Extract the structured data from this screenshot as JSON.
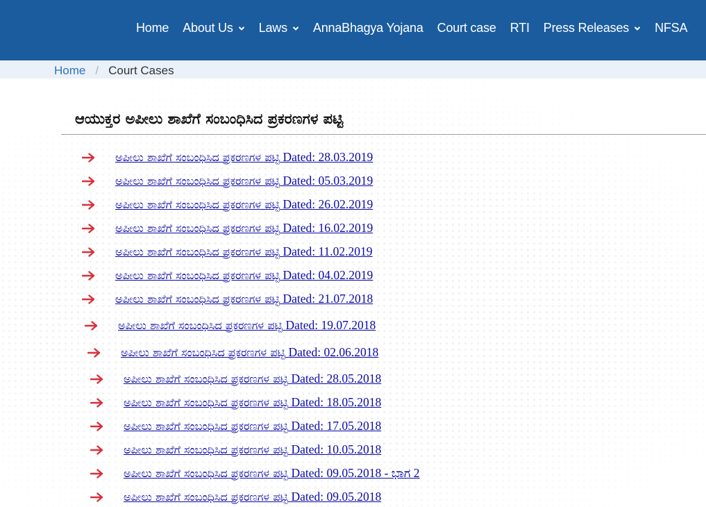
{
  "nav": {
    "items": [
      {
        "label": "Home",
        "has_dropdown": false
      },
      {
        "label": "About Us",
        "has_dropdown": true
      },
      {
        "label": "Laws",
        "has_dropdown": true
      },
      {
        "label": "AnnaBhagya Yojana",
        "has_dropdown": false
      },
      {
        "label": "Court case",
        "has_dropdown": false
      },
      {
        "label": "RTI",
        "has_dropdown": false
      },
      {
        "label": "Press Releases",
        "has_dropdown": true
      },
      {
        "label": "NFSA",
        "has_dropdown": false
      }
    ]
  },
  "breadcrumb": {
    "home": "Home",
    "separator": "/",
    "current": "Court Cases"
  },
  "page": {
    "title": "ಆಯುಕ್ತರ ಅಪೀಲು ಶಾಖೆಗೆ ಸಂಬಂಧಿಸಿದ ಪ್ರಕರಣಗಳ ಪಟ್ಟಿ"
  },
  "documents": [
    {
      "label": "ಅಪೀಲು ಶಾಖೆಗೆ ಸಂಬಂಧಿಸಿದ ಪ್ರಕರಣಗಳ ಪಟ್ಟಿ",
      "date": "Dated: 28.03.2019"
    },
    {
      "label": "ಅಪೀಲು ಶಾಖೆಗೆ ಸಂಬಂಧಿಸಿದ ಪ್ರಕರಣಗಳ ಪಟ್ಟಿ",
      "date": "Dated: 05.03.2019"
    },
    {
      "label": "ಅಪೀಲು ಶಾಖೆಗೆ ಸಂಬಂಧಿಸಿದ ಪ್ರಕರಣಗಳ ಪಟ್ಟಿ",
      "date": "Dated: 26.02.2019"
    },
    {
      "label": "ಅಪೀಲು ಶಾಖೆಗೆ ಸಂಬಂಧಿಸಿದ ಪ್ರಕರಣಗಳ ಪಟ್ಟಿ",
      "date": "Dated: 16.02.2019"
    },
    {
      "label": "ಅಪೀಲು ಶಾಖೆಗೆ ಸಂಬಂಧಿಸಿದ ಪ್ರಕರಣಗಳ ಪಟ್ಟಿ",
      "date": "Dated: 11.02.2019"
    },
    {
      "label": "ಅಪೀಲು ಶಾಖೆಗೆ ಸಂಬಂಧಿಸಿದ ಪ್ರಕರಣಗಳ ಪಟ್ಟಿ",
      "date": "Dated: 04.02.2019"
    },
    {
      "label": "ಅಪೀಲು ಶಾಖೆಗೆ ಸಂಬಂಧಿಸಿದ ಪ್ರಕರಣಗಳ ಪಟ್ಟಿ",
      "date": "Dated: 21.07.2018"
    },
    {
      "label": "ಅಪೀಲು ಶಾಖೆಗೆ ಸಂಬಂಧಿಸಿದ ಪ್ರಕರಣಗಳ ಪಟ್ಟಿ",
      "date": "Dated: 19.07.2018"
    },
    {
      "label": "ಅಪೀಲು ಶಾಖೆಗೆ ಸಂಬಂಧಿಸಿದ ಪ್ರಕರಣಗಳ ಪಟ್ಟಿ",
      "date": "Dated: 02.06.2018"
    },
    {
      "label": "ಅಪೀಲು ಶಾಖೆಗೆ ಸಂಬಂಧಿಸಿದ ಪ್ರಕರಣಗಳ ಪಟ್ಟಿ",
      "date": "Dated: 28.05.2018"
    },
    {
      "label": "ಅಪೀಲು ಶಾಖೆಗೆ ಸಂಬಂಧಿಸಿದ ಪ್ರಕರಣಗಳ ಪಟ್ಟಿ",
      "date": "Dated: 18.05.2018"
    },
    {
      "label": "ಅಪೀಲು ಶಾಖೆಗೆ ಸಂಬಂಧಿಸಿದ ಪ್ರಕರಣಗಳ ಪಟ್ಟಿ",
      "date": "Dated: 17.05.2018"
    },
    {
      "label": "ಅಪೀಲು ಶಾಖೆಗೆ ಸಂಬಂಧಿಸಿದ ಪ್ರಕರಣಗಳ ಪಟ್ಟಿ",
      "date": "Dated: 10.05.2018"
    },
    {
      "label": "ಅಪೀಲು ಶಾಖೆಗೆ ಸಂಬಂಧಿಸಿದ ಪ್ರಕರಣಗಳ ಪಟ್ಟಿ",
      "date": "Dated: 09.05.2018 - ಭಾಗ 2"
    },
    {
      "label": "ಅಪೀಲು ಶಾಖೆಗೆ ಸಂಬಂಧಿಸಿದ ಪ್ರಕರಣಗಳ ಪಟ್ಟಿ",
      "date": "Dated: 09.05.2018"
    }
  ],
  "icons": {
    "list_bullet": "right-arrow-icon",
    "dropdown": "chevron-down-icon"
  },
  "colors": {
    "header": "#1a5c9e",
    "breadcrumb_bg": "#eaf1f8",
    "link": "#0a0aa8",
    "arrow": "#d9303a"
  }
}
